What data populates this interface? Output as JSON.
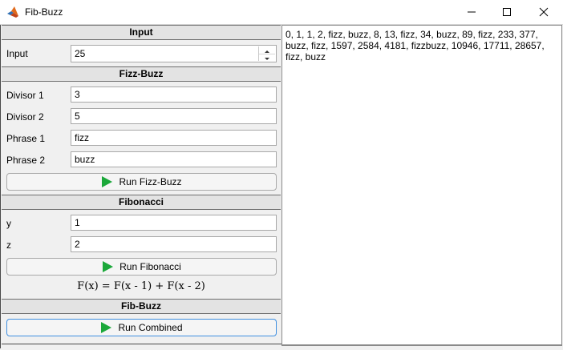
{
  "window": {
    "title": "Fib-Buzz"
  },
  "icons": {
    "app": "matlab-icon",
    "minimize": "minimize-icon",
    "maximize": "maximize-icon",
    "close": "close-icon",
    "play": "play-icon"
  },
  "colors": {
    "play": "#1ba83a",
    "focus_border": "#3f8fe0",
    "section_header": "#e3e3e3"
  },
  "input_section": {
    "title": "Input",
    "input_label": "Input",
    "input_value": "25"
  },
  "fizzbuzz_section": {
    "title": "Fizz-Buzz",
    "divisor1_label": "Divisor 1",
    "divisor1_value": "3",
    "divisor2_label": "Divisor 2",
    "divisor2_value": "5",
    "phrase1_label": "Phrase 1",
    "phrase1_value": "fizz",
    "phrase2_label": "Phrase 2",
    "phrase2_value": "buzz",
    "run_label": "Run Fizz-Buzz"
  },
  "fibonacci_section": {
    "title": "Fibonacci",
    "y_label": "y",
    "y_value": "1",
    "z_label": "z",
    "z_value": "2",
    "run_label": "Run Fibonacci",
    "formula": "F(x) = F(x - 1) + F(x - 2)"
  },
  "fibbuzz_section": {
    "title": "Fib-Buzz",
    "run_label": "Run Combined"
  },
  "output": {
    "text": "0, 1, 1, 2, fizz, buzz, 8, 13, fizz, 34, buzz, 89, fizz, 233, 377, buzz, fizz, 1597, 2584, 4181, fizzbuzz, 10946, 17711, 28657, fizz, buzz"
  }
}
